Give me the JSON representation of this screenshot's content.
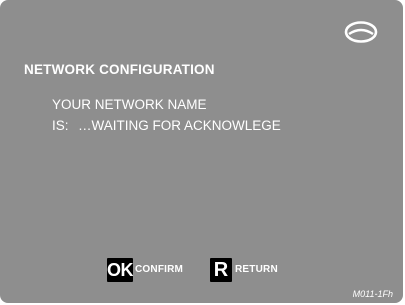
{
  "screen": {
    "logo_icon": "eye-lens-logo-icon",
    "title": "NETWORK CONFIGURATION",
    "name_line1": "YOUR NETWORK NAME",
    "name_label": "IS:",
    "name_value": "…WAITING FOR ACKNOWLEGE",
    "background_color": "#8e8e8e",
    "text_color": "#ffffff"
  },
  "footer": {
    "ok_key": "OK",
    "confirm_label": "CONFIRM",
    "return_key": "R",
    "return_label": "RETURN"
  },
  "screen_code": "M011-1Fh"
}
